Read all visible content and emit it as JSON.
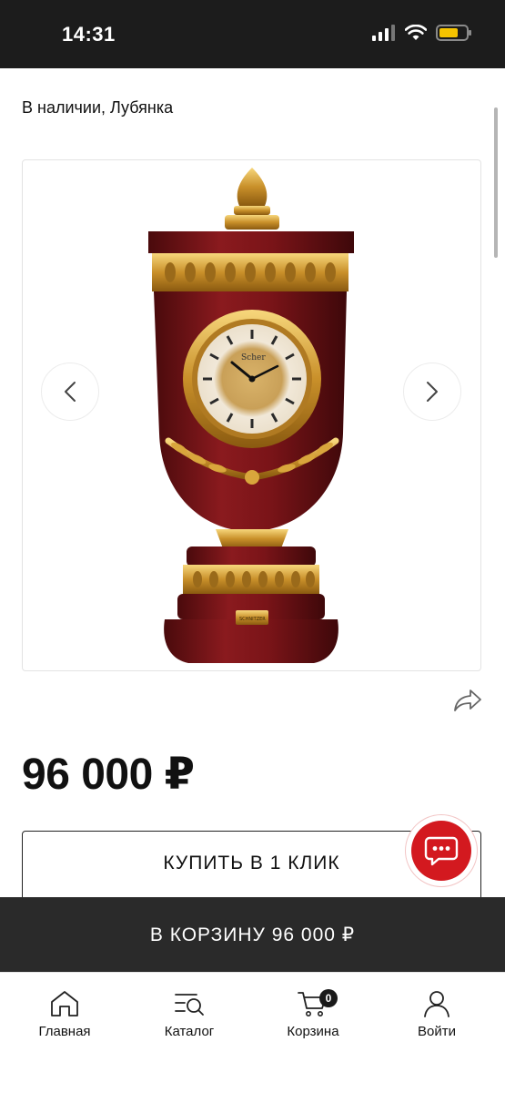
{
  "status_bar": {
    "time": "14:31"
  },
  "availability": "В наличии, Лубянка",
  "gallery": {
    "watch_brand": "Scher",
    "plaque_text": "SCHNITZER"
  },
  "price": "96 000 ₽",
  "buttons": {
    "buy_one_click": "КУПИТЬ В 1 КЛИК",
    "add_to_cart": "В КОРЗИНУ 96 000 ₽"
  },
  "tabs": [
    {
      "label": "Главная",
      "icon": "home-icon"
    },
    {
      "label": "Каталог",
      "icon": "catalog-search-icon"
    },
    {
      "label": "Корзина",
      "icon": "cart-icon",
      "badge": "0"
    },
    {
      "label": "Войти",
      "icon": "user-icon"
    }
  ],
  "colors": {
    "status_bar_bg": "#1c1c1c",
    "cart_bar_bg": "#2a2a2a",
    "chat_red": "#d3191f",
    "battery": "#f5c400"
  }
}
